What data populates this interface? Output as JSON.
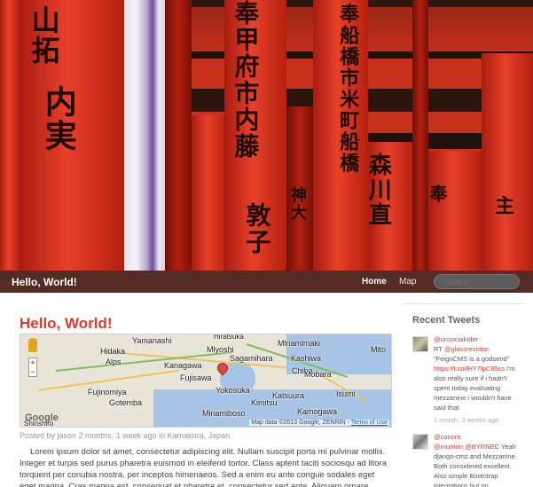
{
  "navbar": {
    "brand": "Hello, World!",
    "links": [
      {
        "label": "Home",
        "active": true
      },
      {
        "label": "Map",
        "active": false
      }
    ],
    "search_placeholder": "Search"
  },
  "hero": {
    "glyphs": [
      "山拓",
      "内実",
      "奉甲府市内藤",
      "奉船橋市米町船橋",
      "森川直",
      "敦子",
      "神大",
      "奉",
      "主"
    ]
  },
  "post": {
    "title": "Hello, World!",
    "map": {
      "places": [
        "Yamanashi",
        "Hiratsuka",
        "Hidaka",
        "Mlyoshi",
        "Mlnamlmaki",
        "Kashiwa",
        "Chiba",
        "Mito",
        "Alps",
        "Kanagawa",
        "Fujisawa",
        "Sagamihara",
        "Mobara",
        "Fujinomiya",
        "Yokosuka",
        "Katsuura",
        "Isumi",
        "Gotemba",
        "Kimitsu",
        "Kamogawa",
        "Minamiboso",
        "Shinshiro"
      ],
      "logo": "Google",
      "attribution": "Map data ©2013 Google, ZENRIN -",
      "terms_label": "Terms of Use",
      "zoom_in": "+",
      "zoom_out": "−"
    },
    "meta": "Posted by jason 2 months, 1 week ago in Kamakura, Japan",
    "body": "Lorem ipsum dolor sit amet, consectetur adipiscing elit. Nullam suscipit porta mi pulvinar mollis. Integer et turpis sed purus pharetra euismod in eleifend tortor. Class aptent taciti sociosqu ad litora torquent per conubia nostra, per inceptos himenaeos. Sed a enim eu ante congue sodales eget eget magna. Cras magna est, consequat et pharetra et, consectetur sed ante. Aliquam ornare adipiscing velit in malesuada. Praesent"
  },
  "sidebar": {
    "title": "Recent Tweets",
    "tweets": [
      {
        "user": "@unsocialnder",
        "prefix": "RT",
        "mention": "@glassresistor:",
        "quote": "\"FeignCMS is a godsend\"",
        "link": "https://t.co/lHY7lpC85cs",
        "rest": "i'm also really sure if i hadn't spent today evaluating mezzanine i wouldn't have said that",
        "time": "1 month, 3 weeks ago"
      },
      {
        "user": "@conoro",
        "mention": "@murrion @BYRNEC",
        "rest": "Yeah django-cms and Mezzanine. Both considered excellent. Also simple Bootstrap integrations but no"
      }
    ]
  },
  "colors": {
    "accent": "#e03a2d",
    "navbar": "#282828"
  }
}
